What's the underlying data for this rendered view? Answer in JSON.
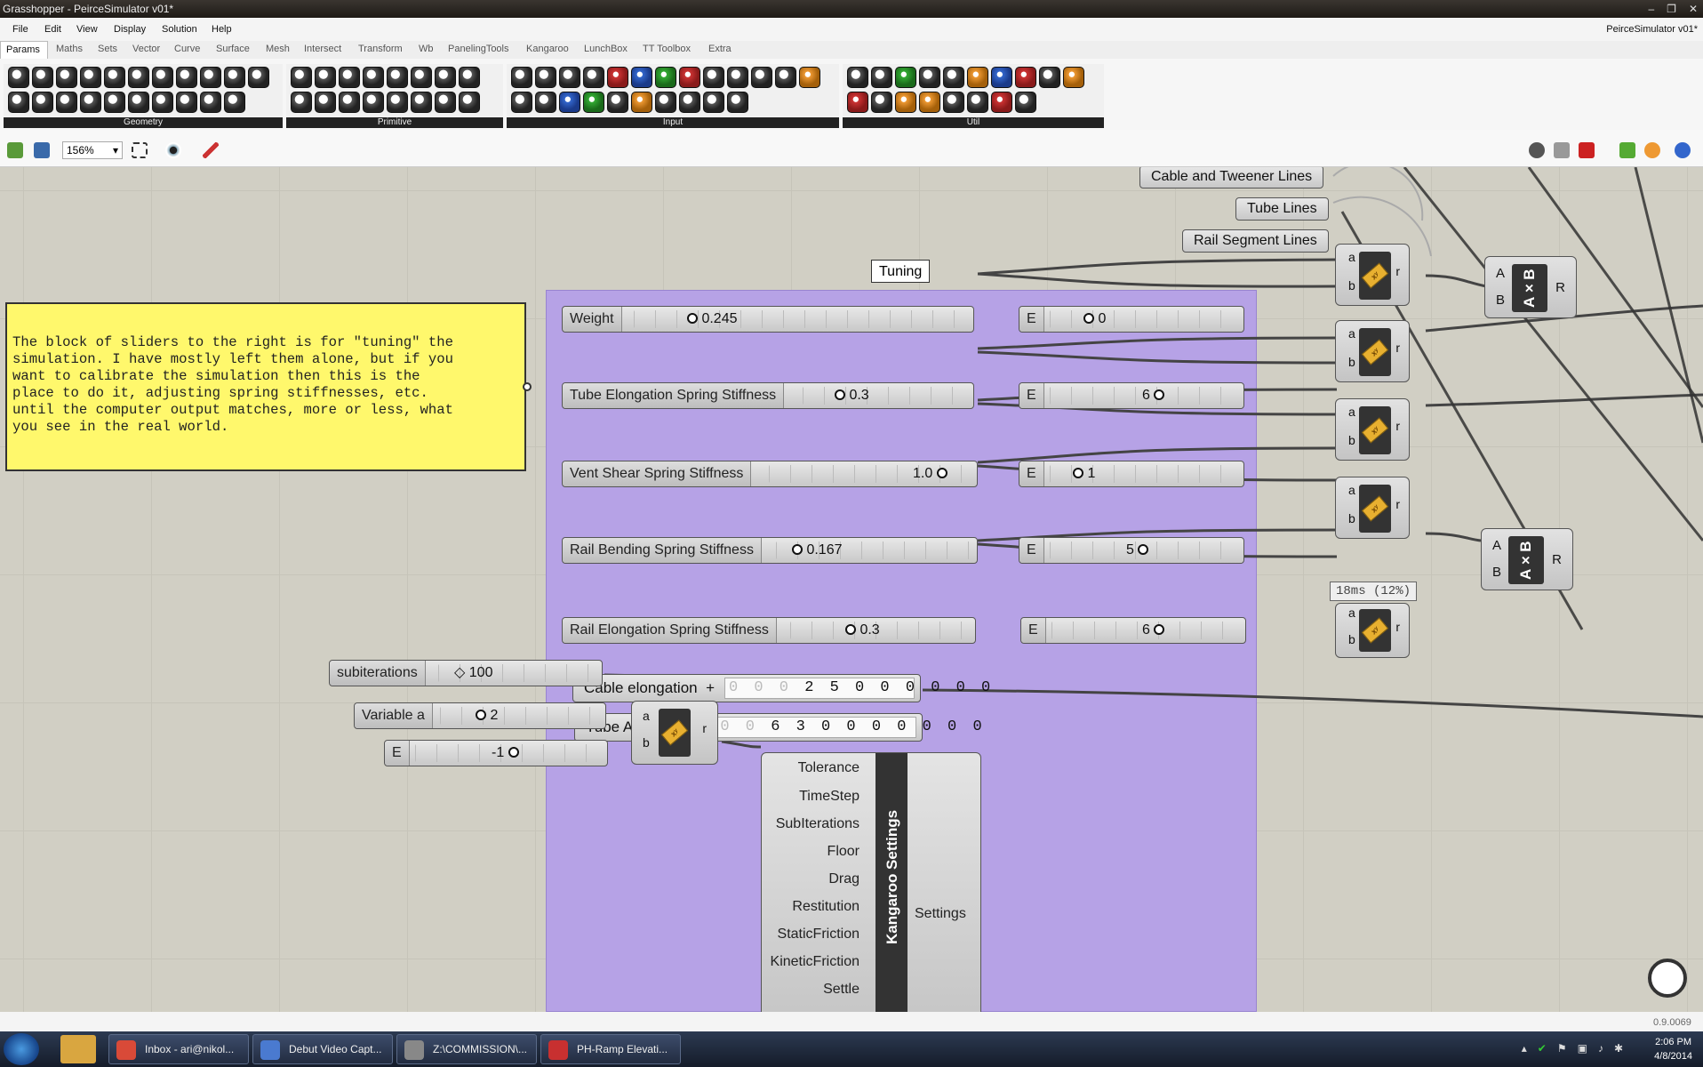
{
  "window": {
    "title": "Grasshopper - PeirceSimulator v01*",
    "controls": [
      "–",
      "❐",
      "✕"
    ]
  },
  "menu": [
    "File",
    "Edit",
    "View",
    "Display",
    "Solution",
    "Help"
  ],
  "document_name": "PeirceSimulator v01*",
  "tabs": [
    "Params",
    "Maths",
    "Sets",
    "Vector",
    "Curve",
    "Surface",
    "Mesh",
    "Intersect",
    "Transform",
    "Wb",
    "PanelingTools",
    "Kangaroo",
    "LunchBox",
    "TT Toolbox",
    "Extra"
  ],
  "ribbon_groups": [
    "Geometry",
    "Primitive",
    "Input",
    "Util"
  ],
  "zoom": "156%",
  "group_label": "Tuning",
  "note": "The block of sliders to the right is for \"tuning\" the\nsimulation. I have mostly left them alone, but if you\nwant to calibrate the simulation then this is the\nplace to do it, adjusting spring stiffnesses, etc.\nuntil the computer output matches, more or less, what\nyou see in the real world.",
  "float_params": [
    "Cable and Tweener Lines",
    "Tube Lines",
    "Rail Segment Lines"
  ],
  "sliders": [
    {
      "label": "Weight",
      "value": "0.245"
    },
    {
      "label": "Tube Elongation Spring Stiffness",
      "value": "0.3"
    },
    {
      "label": "Vent Shear Spring Stiffness",
      "value": "1.0"
    },
    {
      "label": "Rail Bending Spring Stiffness",
      "value": "0.167"
    },
    {
      "label": "Rail Elongation Spring Stiffness",
      "value": "0.3"
    }
  ],
  "exp_sliders": [
    {
      "label": "E",
      "value": "0"
    },
    {
      "label": "E",
      "value": "6"
    },
    {
      "label": "E",
      "value": "1"
    },
    {
      "label": "E",
      "value": "5"
    },
    {
      "label": "E",
      "value": "6"
    }
  ],
  "number_inputs": [
    {
      "label": "Cable elongation",
      "sign": "+",
      "dim": "0 0 0 ",
      "digits": "2 5 0 0 0",
      "decimal": "0 0 0"
    },
    {
      "label": "Tube Angle",
      "sign": "+",
      "dim": "0 0 0 ",
      "digits": "6",
      "decimal": "3 0 0 0 0 0 0 0"
    }
  ],
  "power": {
    "a": "a",
    "b": "b",
    "r": "r",
    "icon_text": "xʸ"
  },
  "multiply": {
    "a": "A",
    "b": "B",
    "r": "R",
    "icon_text": "A×B"
  },
  "timing": "18ms (12%)",
  "lower_sliders": [
    {
      "label": "subiterations",
      "value": "100"
    },
    {
      "label": "Variable a",
      "value": "2"
    },
    {
      "label": "E",
      "value": "-1"
    }
  ],
  "kangaroo": {
    "title": "Kangaroo Settings",
    "inputs": [
      "Tolerance",
      "TimeStep",
      "SubIterations",
      "Floor",
      "Drag",
      "Restitution",
      "StaticFriction",
      "KineticFriction",
      "Settle"
    ],
    "output": "Settings"
  },
  "version": "0.9.0069",
  "taskbar": [
    {
      "label": "Inbox - ari@nikol...",
      "color": "#d94a38"
    },
    {
      "label": "Debut Video Capt...",
      "color": "#4a7ad0"
    },
    {
      "label": "Z:\\COMMISSION\\...",
      "color": "#888888"
    },
    {
      "label": "PH-Ramp Elevati...",
      "color": "#c83030"
    }
  ],
  "clock": {
    "time": "2:06 PM",
    "date": "4/8/2014"
  }
}
